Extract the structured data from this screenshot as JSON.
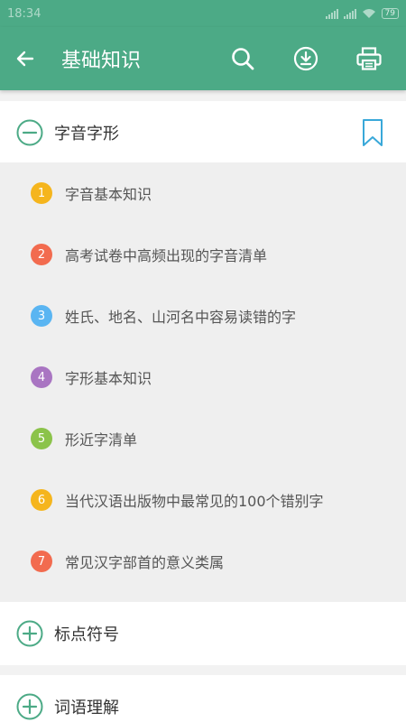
{
  "status_bar": {
    "time": "18:34",
    "battery": "79"
  },
  "toolbar": {
    "title": "基础知识",
    "back_icon": "arrow-left-icon",
    "actions": [
      "search-icon",
      "download-icon",
      "print-icon"
    ],
    "bg_color": "#4caa86"
  },
  "sections": [
    {
      "label": "字音字形",
      "expanded": true
    },
    {
      "label": "标点符号",
      "expanded": false
    },
    {
      "label": "词语理解",
      "expanded": false
    }
  ],
  "sub_items": [
    {
      "num": "1",
      "label": "字音基本知识",
      "color": "#f5b51d"
    },
    {
      "num": "2",
      "label": "高考试卷中高频出现的字音清单",
      "color": "#f26b4f"
    },
    {
      "num": "3",
      "label": "姓氏、地名、山河名中容易读错的字",
      "color": "#5ab5f2"
    },
    {
      "num": "4",
      "label": "字形基本知识",
      "color": "#a975c2"
    },
    {
      "num": "5",
      "label": "形近字清单",
      "color": "#8bc34a"
    },
    {
      "num": "6",
      "label": "当代汉语出版物中最常见的100个错别字",
      "color": "#f5b51d"
    },
    {
      "num": "7",
      "label": "常见汉字部首的意义类属",
      "color": "#f26b4f"
    }
  ],
  "colors": {
    "accent": "#4caa86",
    "bookmark": "#39a8d9"
  }
}
